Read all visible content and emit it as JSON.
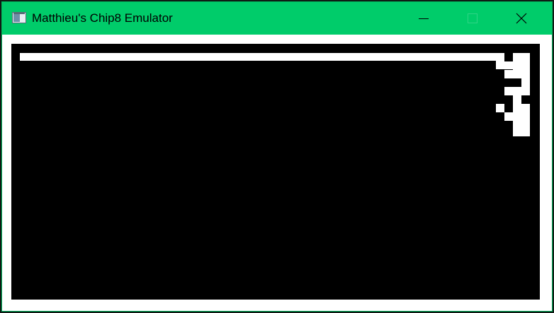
{
  "window": {
    "title": "Matthieu's Chip8 Emulator",
    "accent_color": "#00cc6a",
    "icons": {
      "app": "app-window-icon",
      "minimize": "minimize-icon",
      "maximize": "maximize-icon",
      "close": "close-icon"
    }
  },
  "display": {
    "pixel_on_color": "#ffffff",
    "pixel_off_color": "#000000"
  }
}
